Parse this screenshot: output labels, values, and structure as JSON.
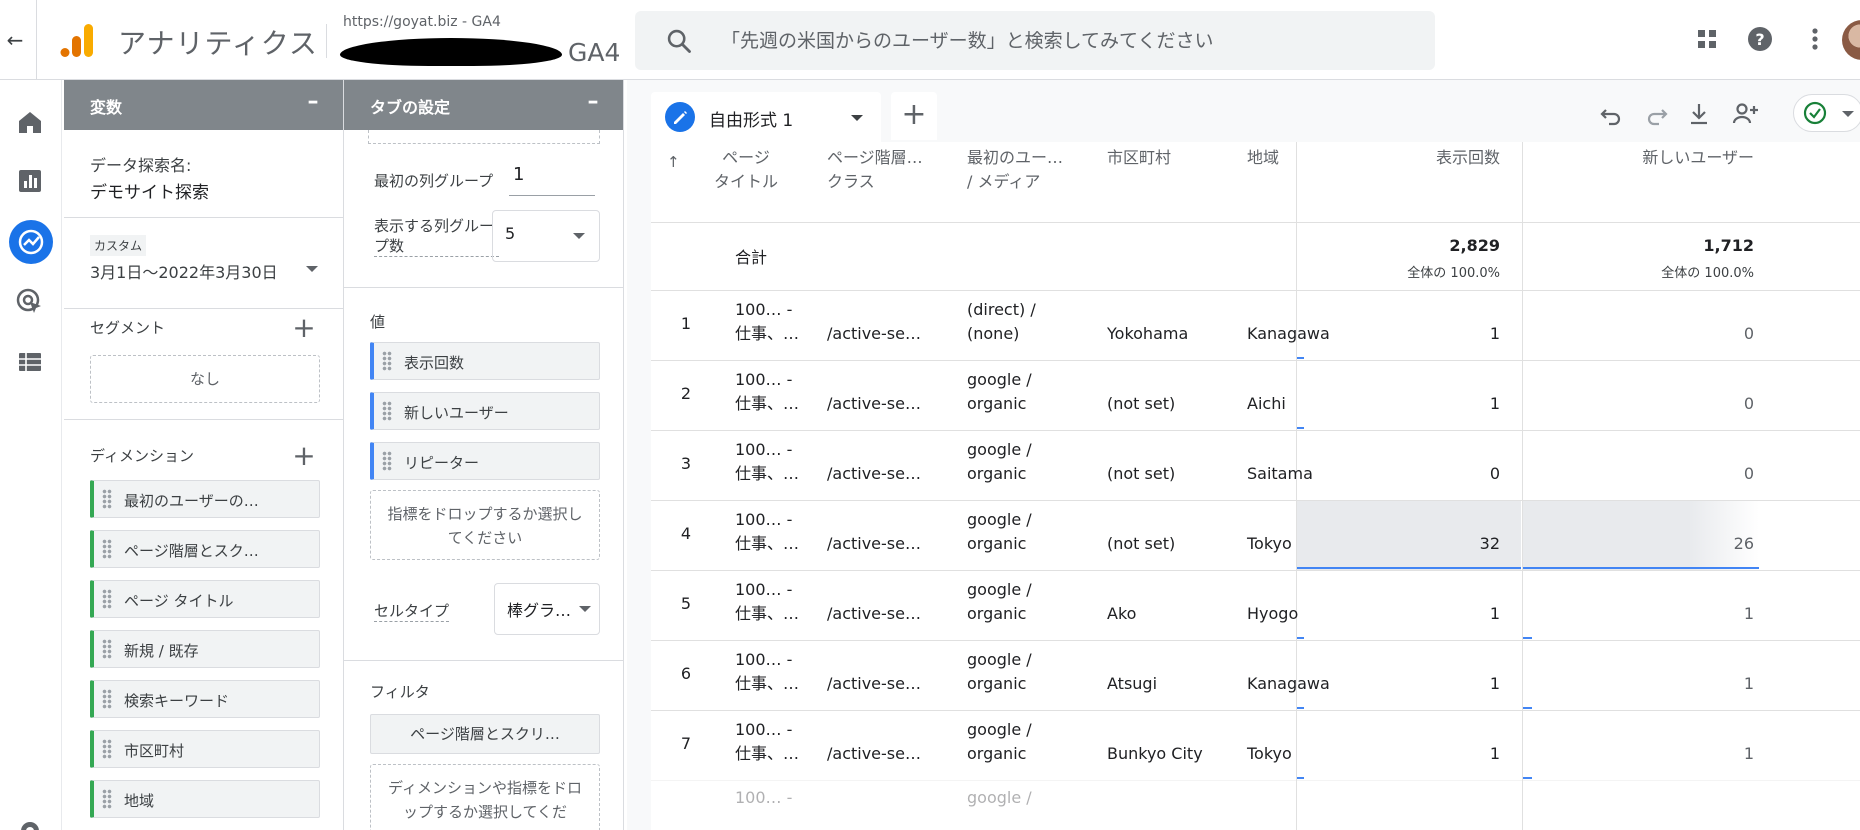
{
  "header": {
    "back_icon": "arrow-back-icon",
    "app_name": "アナリティクス",
    "property_top": "https://goyat.biz - GA4",
    "property_name": "GA4",
    "search_placeholder": "「先週の米国からのユーザー数」と検索してみてください",
    "icons": [
      "search-icon",
      "apps-icon",
      "help-icon",
      "more-vert-icon"
    ]
  },
  "nav": {
    "icons": [
      "home-icon",
      "reports-icon",
      "explore-icon",
      "advertising-icon",
      "configure-icon",
      "settings-icon"
    ],
    "active": "explore-icon",
    "accent": "#1a73e8"
  },
  "variables": {
    "title": "変数",
    "collapse": "–",
    "exploration_label": "データ探索名:",
    "exploration_name": "デモサイト探索",
    "date_tag": "カスタム",
    "date_range": "3月1日～2022年3月30日",
    "segment_label": "セグメント",
    "segment_none": "なし",
    "dimension_label": "ディメンション",
    "add": "+",
    "dimensions": [
      "最初のユーザーの…",
      "ページ階層とスク…",
      "ページ タイトル",
      "新規 / 既存",
      "検索キーワード",
      "市区町村",
      "地域"
    ]
  },
  "tab_settings": {
    "title": "タブの設定",
    "collapse": "–",
    "first_col_group_label": "最初の列グループ",
    "first_col_group_value": "1",
    "show_col_groups_label": "表示する列グループ数",
    "show_col_groups_value": "5",
    "values_label": "値",
    "metrics": [
      "表示回数",
      "新しいユーザー",
      "リピーター"
    ],
    "metric_drop": "指標をドロップするか選択してください",
    "cell_type_label": "セルタイプ",
    "cell_type_value": "棒グラ…",
    "filter_label": "フィルタ",
    "filter_chip": "ページ階層とスクリ…",
    "filter_drop": "ディメンションや指標をドロップするか選択してくだ"
  },
  "canvas": {
    "tab_label": "自由形式 1",
    "tab_add": "+",
    "toolbar_icons": [
      "undo-icon",
      "redo-icon",
      "download-icon",
      "share-icon",
      "check-circle-icon"
    ],
    "status_color": "#188038"
  },
  "table": {
    "sort_icon": "↑",
    "headers": {
      "page_title": [
        "ページ",
        "タイトル"
      ],
      "page_path": [
        "ページ階層…",
        "クラス"
      ],
      "first_user": [
        "最初のユー…",
        "/ メディア"
      ],
      "city": "市区町村",
      "region": "地域",
      "views": "表示回数",
      "new_users": "新しいユーザー"
    },
    "total": {
      "label": "合計",
      "views": "2,829",
      "views_pct": "全体の 100.0%",
      "new_users": "1,712",
      "new_users_pct": "全体の 100.0%"
    },
    "rows": [
      {
        "n": "1",
        "title1": "100… -",
        "title2": "仕事、…",
        "path": "/active-se…",
        "src1": "(direct) /",
        "src2": "(none)",
        "city": "Yokohama",
        "region": "Kanagawa",
        "views": "1",
        "new_users": "0"
      },
      {
        "n": "2",
        "title1": "100… -",
        "title2": "仕事、…",
        "path": "/active-se…",
        "src1": "google /",
        "src2": "organic",
        "city": "(not set)",
        "region": "Aichi",
        "views": "1",
        "new_users": "0"
      },
      {
        "n": "3",
        "title1": "100… -",
        "title2": "仕事、…",
        "path": "/active-se…",
        "src1": "google /",
        "src2": "organic",
        "city": "(not set)",
        "region": "Saitama",
        "views": "0",
        "new_users": "0"
      },
      {
        "n": "4",
        "title1": "100… -",
        "title2": "仕事、…",
        "path": "/active-se…",
        "src1": "google /",
        "src2": "organic",
        "city": "(not set)",
        "region": "Tokyo",
        "views": "32",
        "new_users": "26"
      },
      {
        "n": "5",
        "title1": "100… -",
        "title2": "仕事、…",
        "path": "/active-se…",
        "src1": "google /",
        "src2": "organic",
        "city": "Ako",
        "region": "Hyogo",
        "views": "1",
        "new_users": "1"
      },
      {
        "n": "6",
        "title1": "100… -",
        "title2": "仕事、…",
        "path": "/active-se…",
        "src1": "google /",
        "src2": "organic",
        "city": "Atsugi",
        "region": "Kanagawa",
        "views": "1",
        "new_users": "1"
      },
      {
        "n": "7",
        "title1": "100… -",
        "title2": "仕事、…",
        "path": "/active-se…",
        "src1": "google /",
        "src2": "organic",
        "city": "Bunkyo City",
        "region": "Tokyo",
        "views": "1",
        "new_users": "1"
      }
    ],
    "partial_row": {
      "title1": "100… -",
      "src1": "google /"
    }
  }
}
